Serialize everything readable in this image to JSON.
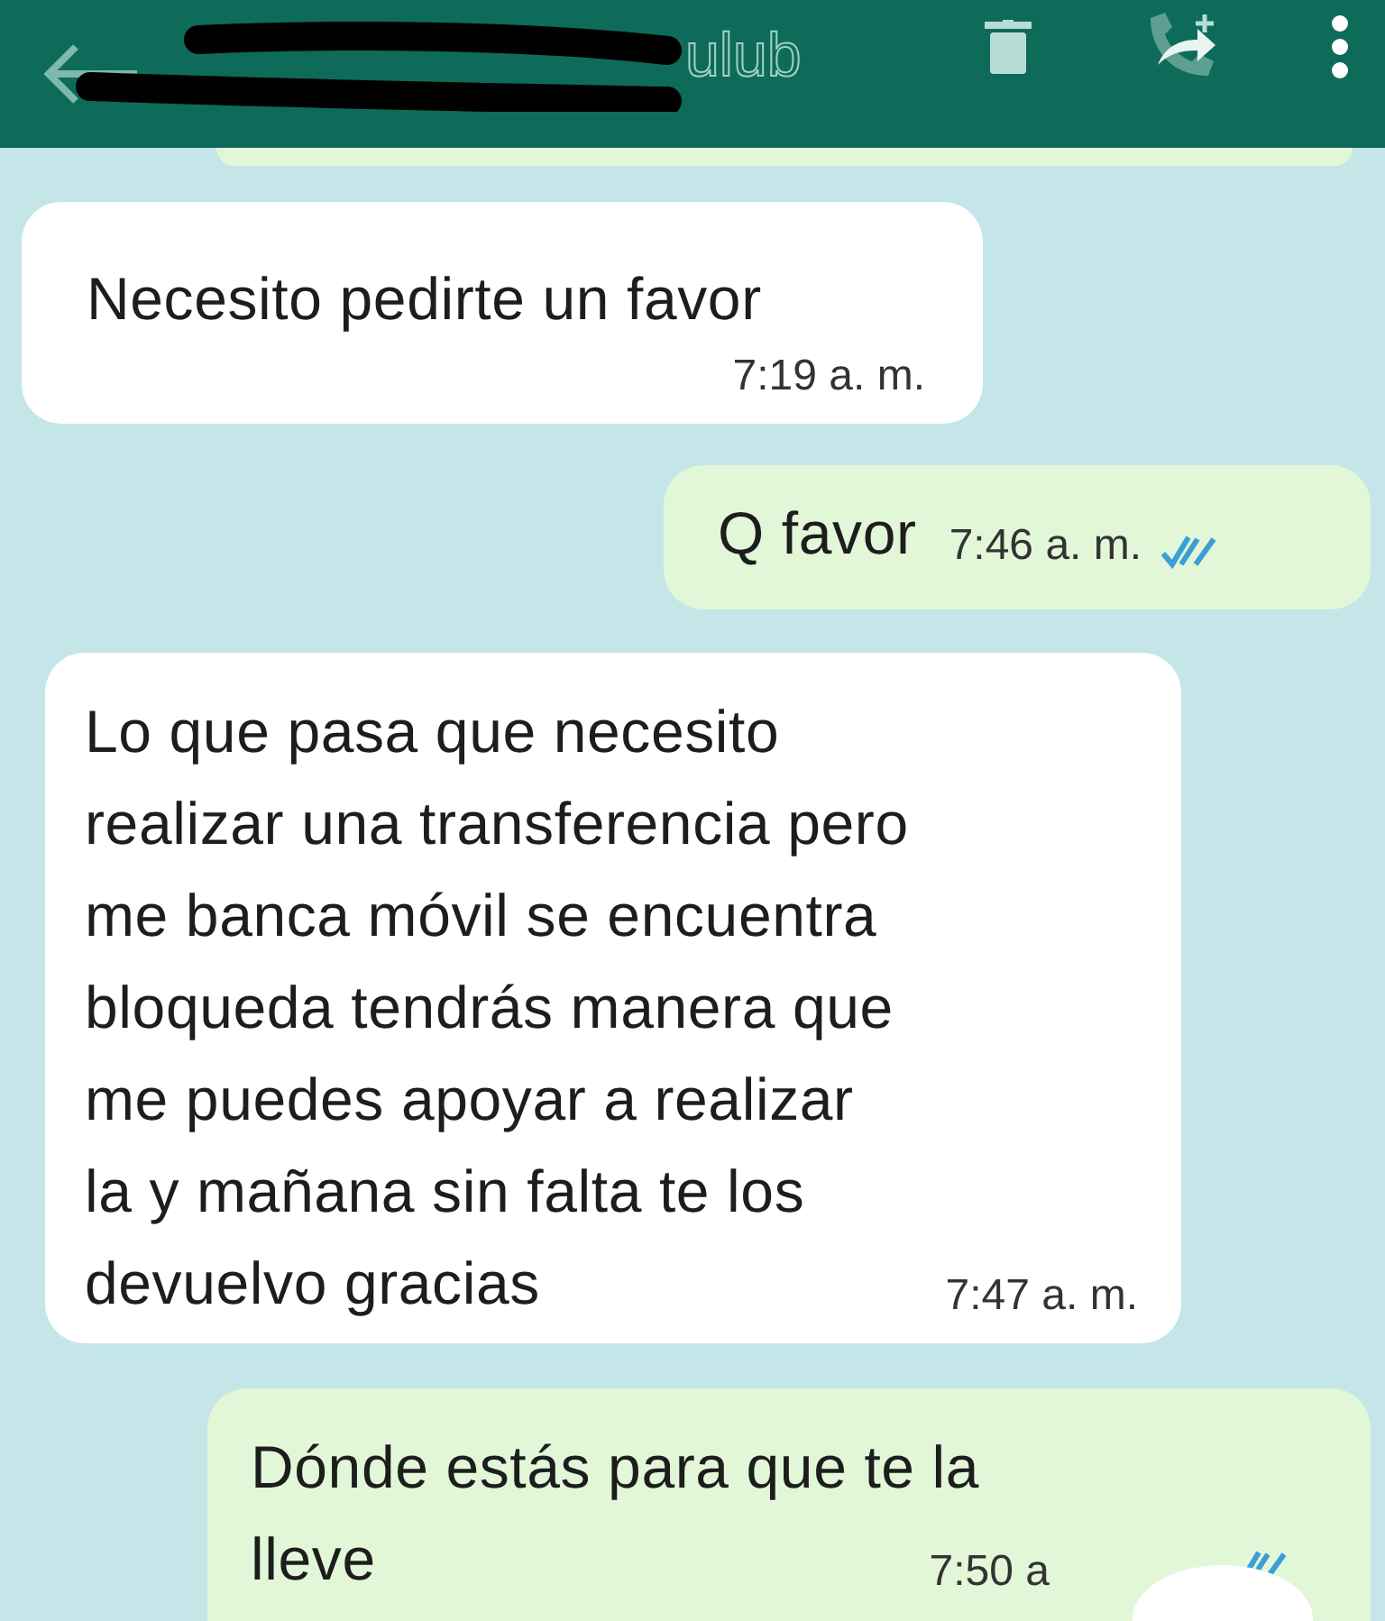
{
  "header": {
    "title_fragment": "ulub"
  },
  "messages": [
    {
      "kind": "incoming",
      "lines": [
        "Necesito pedirte un favor"
      ],
      "time": "7:19 a. m."
    },
    {
      "kind": "outgoing",
      "lines": [
        "Q favor"
      ],
      "time": "7:46 a. m.",
      "read": true
    },
    {
      "kind": "incoming",
      "lines": [
        "Lo que pasa que necesito",
        "realizar una transferencia pero",
        "me banca móvil se encuentra",
        "bloqueda  tendrás manera que",
        "me puedes apoyar a realizar",
        "la  y mañana sin falta te los",
        "devuelvo gracias"
      ],
      "time": "7:47 a. m."
    },
    {
      "kind": "outgoing",
      "lines": [
        "Dónde estás para que te la",
        "lleve"
      ],
      "time": "7:50 a",
      "read": true
    }
  ]
}
